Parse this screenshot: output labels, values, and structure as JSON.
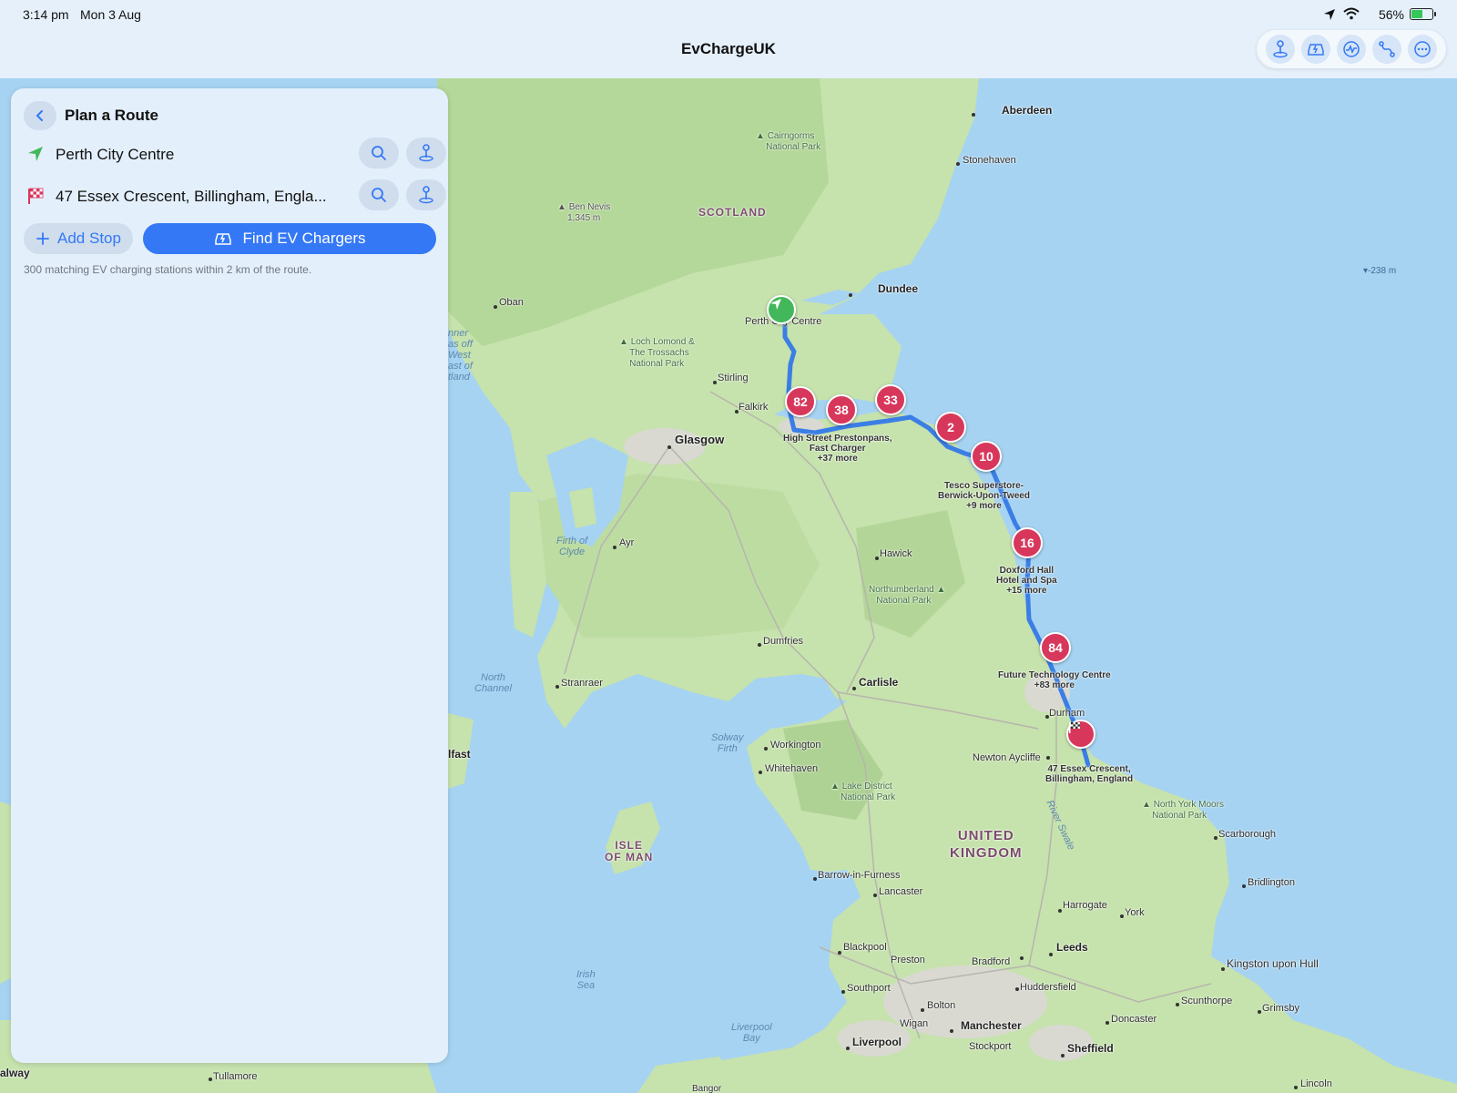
{
  "status_bar": {
    "time": "3:14 pm",
    "date": "Mon 3 Aug",
    "battery_percent": "56%",
    "battery_level": 0.56
  },
  "app": {
    "title": "EvChargeUK"
  },
  "toolbar": {
    "icons": [
      "pin-icon",
      "ev-car-icon",
      "activity-icon",
      "route-icon",
      "more-icon"
    ]
  },
  "panel": {
    "title": "Plan a Route",
    "origin": "Perth City Centre",
    "destination": "47 Essex Crescent, Billingham, Engla...",
    "add_stop_label": "Add Stop",
    "find_label": "Find EV Chargers",
    "status": "300 matching EV charging stations within 2 km of the route."
  },
  "map": {
    "depth_label": "▾-238 m",
    "cities": [
      "Aberdeen",
      "Stonehaven",
      "Dundee",
      "Perth City Centre",
      "Stirling",
      "Falkirk",
      "Glasgow",
      "Oban",
      "Ayr",
      "Hawick",
      "Dumfries",
      "Carlisle",
      "Stranraer",
      "Workington",
      "Whitehaven",
      "Durham",
      "Newton Aycliffe",
      "Scarborough",
      "Bridlington",
      "Harrogate",
      "York",
      "Leeds",
      "Bradford",
      "Huddersfield",
      "Kingston upon Hull",
      "Scunthorpe",
      "Grimsby",
      "Doncaster",
      "Sheffield",
      "Manchester",
      "Stockport",
      "Bolton",
      "Wigan",
      "Liverpool",
      "Preston",
      "Blackpool",
      "Southport",
      "Lancaster",
      "Barrow-in-Furness",
      "Lincoln",
      "Tullamore",
      "Bangor",
      "lfast",
      "alway"
    ],
    "regions": {
      "scotland": "SCOTLAND",
      "uk_line1": "UNITED",
      "uk_line2": "KINGDOM",
      "iom_line1": "ISLE",
      "iom_line2": "OF MAN"
    },
    "water": [
      "Firth of",
      "Clyde",
      "North",
      "Channel",
      "Solway",
      "Firth",
      "Irish",
      "Sea",
      "Liverpool",
      "Bay",
      "River Swale"
    ],
    "parks": [
      "Cairngorms",
      "National Park",
      "Loch Lomond &",
      "The Trossachs",
      "National Park",
      "Northumberland",
      "National Park",
      "Lake District",
      "National Park",
      "North York Moors",
      "National Park",
      "Ben Nevis",
      "1,345 m",
      "nner",
      "as off",
      "West",
      "ast of",
      "tland"
    ],
    "pin_labels": [
      "High Street Prestonpans,",
      "Fast Charger",
      "+37 more",
      "Tesco Superstore-",
      "Berwick-Upon-Tweed",
      "+9 more",
      "Doxford Hall",
      "Hotel and Spa",
      "+15 more",
      "Future Technology Centre",
      "+83 more",
      "47 Essex Crescent,",
      "Billingham, England"
    ],
    "clusters": [
      "82",
      "38",
      "33",
      "2",
      "10",
      "16",
      "84"
    ]
  }
}
